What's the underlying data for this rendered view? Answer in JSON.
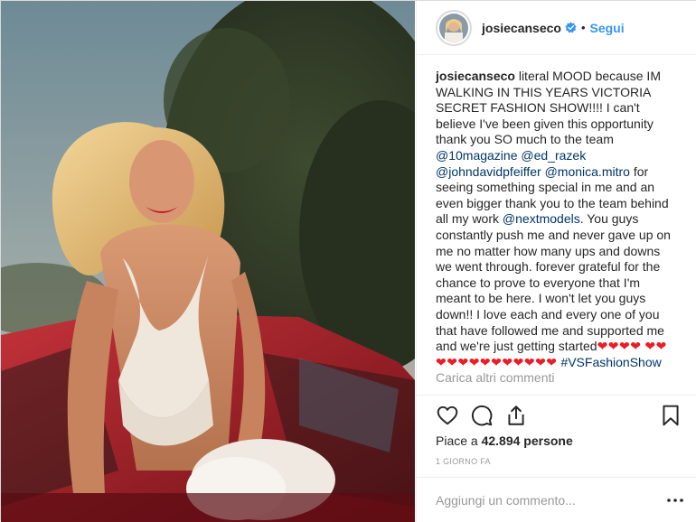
{
  "header": {
    "username": "josiecanseco",
    "separator": "•",
    "follow_label": "Segui"
  },
  "caption": {
    "username": "josiecanseco",
    "t1": " literal MOOD because IM WALKING IN THIS YEARS VICTORIA SECRET FASHION SHOW!!!! I can't believe I've been given this opportunity thank you SO much to the team ",
    "m1": "@10magazine",
    "m2": "@ed_razek",
    "m3": "@johndavidpfeiffer",
    "m4": "@monica.mitro",
    "t2": " for seeing something special in me and an even bigger thank you to the team behind all my work ",
    "m5": "@nextmodels",
    "t3": ". You guys constantly push me and never gave up on me no matter how many ups and downs we went through. forever grateful for the chance to prove to everyone that I'm meant to be here. I won't let you guys down!! I love each and every one of you that have followed me and supported me and we're just getting started",
    "hearts1": "❤❤❤❤",
    "hearts2": "❤❤❤❤❤❤❤❤❤❤❤❤❤",
    "hashtag": "#VSFashionShow"
  },
  "load_more": "Carica altri commenti",
  "likes": {
    "prefix": "Piace a ",
    "count": "42.894",
    "suffix": " persone"
  },
  "timestamp": "1 GIORNO FA",
  "comment_input": {
    "placeholder": "Aggiungi un commento..."
  },
  "icons": {
    "verified": "verified-badge-icon",
    "like": "heart-icon",
    "comment": "comment-bubble-icon",
    "share": "share-icon",
    "save": "bookmark-icon",
    "more": "more-options-icon"
  },
  "colors": {
    "link": "#3897f0",
    "mention": "#003569",
    "heart": "#ed1c24",
    "muted": "#999999"
  }
}
